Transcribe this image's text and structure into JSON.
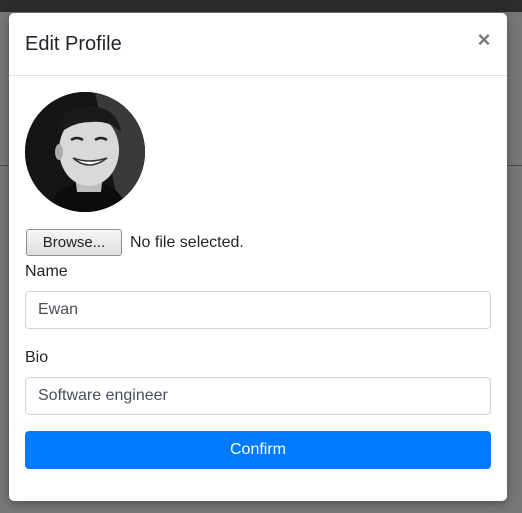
{
  "modal": {
    "title": "Edit Profile",
    "close_icon": "close-icon",
    "close_glyph": "×"
  },
  "avatar": {
    "description_icon": "profile-photo"
  },
  "file_input": {
    "button_label": "Browse...",
    "status": "No file selected."
  },
  "form": {
    "name_label": "Name",
    "name_value": "Ewan",
    "bio_label": "Bio",
    "bio_value": "Software engineer",
    "confirm_label": "Confirm"
  },
  "colors": {
    "accent": "#007bff",
    "backdrop": "#777777"
  }
}
